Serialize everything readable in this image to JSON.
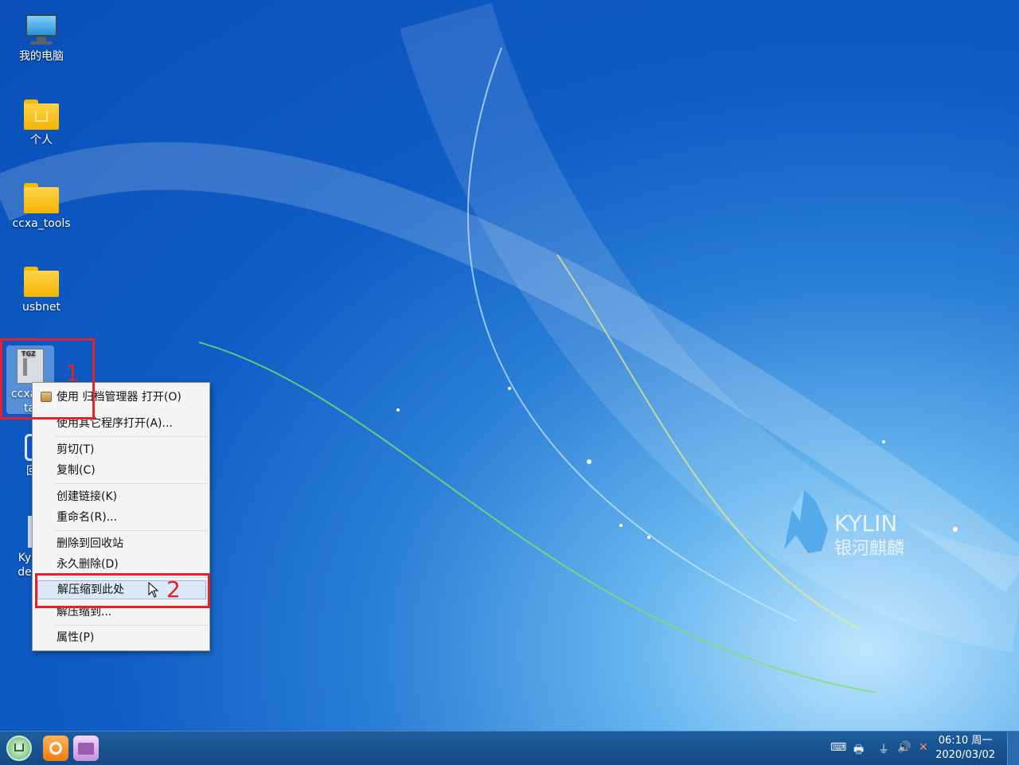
{
  "desktop": {
    "icons": [
      {
        "label": "我的电脑",
        "icon": "computer-icon"
      },
      {
        "label": "个人",
        "icon": "home-folder-icon"
      },
      {
        "label": "ccxa_tools",
        "icon": "folder-icon"
      },
      {
        "label": "usbnet",
        "icon": "folder-icon"
      },
      {
        "label": "ccxa",
        "label2": "ta",
        "icon": "tgz-archive-icon"
      },
      {
        "label": "回",
        "icon": "trash-icon"
      },
      {
        "label": "Kyli",
        "label2": "des",
        "icon": "desktop-file-icon"
      }
    ],
    "archive_badge": "TGZ"
  },
  "wallpaper": {
    "brand": "KYLIN",
    "brand_cn": "银河麒麟"
  },
  "annotations": {
    "step1": "1",
    "step2": "2",
    "color": "#e8202a"
  },
  "context_menu": {
    "items": [
      {
        "label": "使用 归档管理器 打开(O)",
        "icon": "archive-manager-icon"
      },
      {
        "label": "使用其它程序打开(A)..."
      },
      {
        "label": "剪切(T)"
      },
      {
        "label": "复制(C)"
      },
      {
        "label": "创建链接(K)"
      },
      {
        "label": "重命名(R)..."
      },
      {
        "label": "删除到回收站"
      },
      {
        "label": "永久删除(D)"
      },
      {
        "label": "解压缩到此处",
        "highlighted": true
      },
      {
        "label": "解压缩到..."
      },
      {
        "label": "属性(P)"
      }
    ]
  },
  "taskbar": {
    "clock_time": "06:10 周一",
    "clock_date": "2020/03/02",
    "apps": [
      "start-menu-icon",
      "firefox-icon",
      "file-manager-icon"
    ],
    "tray": [
      "keyboard-icon",
      "printer-icon",
      "power-plug-icon",
      "volume-icon",
      "network-disconnected-icon"
    ]
  },
  "colors": {
    "taskbar": "#134a82",
    "menu_bg": "#f4f4f4",
    "menu_highlight": "#dbe8f7"
  }
}
